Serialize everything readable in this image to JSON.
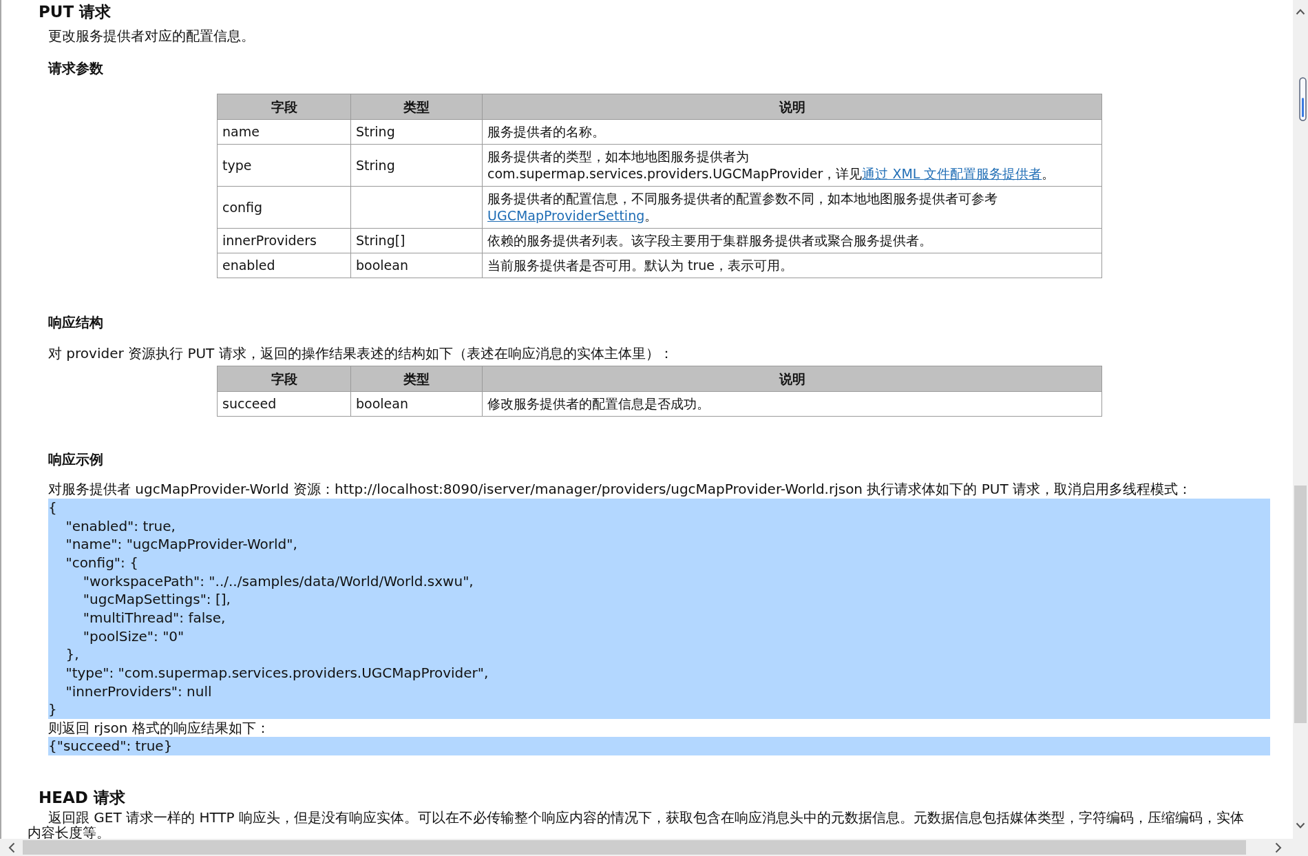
{
  "put_request": {
    "heading": "PUT 请求",
    "description": "更改服务提供者对应的配置信息。",
    "request_parameters": {
      "heading": "请求参数",
      "table": {
        "columns": [
          "字段",
          "类型",
          "说明"
        ],
        "rows": [
          {
            "field": "name",
            "type": "String",
            "description": [
              {
                "kind": "text",
                "text": "服务提供者的名称。"
              }
            ]
          },
          {
            "field": "type",
            "type": "String",
            "description": [
              {
                "kind": "text",
                "text": "服务提供者的类型，如本地地图服务提供者为 com.supermap.services.providers.UGCMapProvider，详见"
              },
              {
                "kind": "link",
                "text": "通过 XML 文件配置服务提供者"
              },
              {
                "kind": "text",
                "text": "。"
              }
            ]
          },
          {
            "field": "config",
            "description": [
              {
                "kind": "text",
                "text": "服务提供者的配置信息，不同服务提供者的配置参数不同，如本地地图服务提供者可参考"
              },
              {
                "kind": "link",
                "text": "UGCMapProviderSetting"
              },
              {
                "kind": "text",
                "text": "。"
              }
            ]
          },
          {
            "field": "innerProviders",
            "type": "String[]",
            "description": [
              {
                "kind": "text",
                "text": "依赖的服务提供者列表。该字段主要用于集群服务提供者或聚合服务提供者。"
              }
            ]
          },
          {
            "field": "enabled",
            "type": "boolean",
            "description": [
              {
                "kind": "text",
                "text": "当前服务提供者是否可用。默认为 true，表示可用。"
              }
            ]
          }
        ]
      }
    },
    "response_structure": {
      "heading": "响应结构",
      "intro": "对 provider 资源执行 PUT 请求，返回的操作结果表述的结构如下（表述在响应消息的实体主体里）：",
      "table": {
        "columns": [
          "字段",
          "类型",
          "说明"
        ],
        "rows": [
          {
            "field": "succeed",
            "type": "boolean",
            "description": [
              {
                "kind": "text",
                "text": "修改服务提供者的配置信息是否成功。"
              }
            ]
          }
        ]
      }
    },
    "response_example": {
      "heading": "响应示例",
      "intro": "对服务提供者 ugcMapProvider-World 资源：http://localhost:8090/iserver/manager/providers/ugcMapProvider-World.rjson 执行请求体如下的 PUT 请求，取消启用多线程模式：",
      "request_body": [
        "{",
        "    \"enabled\": true,",
        "    \"name\": \"ugcMapProvider-World\",",
        "    \"config\": {",
        "        \"workspacePath\": \"../../samples/data/World/World.sxwu\",",
        "        \"ugcMapSettings\": [],",
        "        \"multiThread\": false,",
        "        \"poolSize\": \"0\"",
        "    },",
        "    \"type\": \"com.supermap.services.providers.UGCMapProvider\",",
        "    \"innerProviders\": null",
        "}"
      ],
      "result_intro": "则返回 rjson 格式的响应结果如下：",
      "result_body": [
        "{\"succeed\": true}"
      ]
    }
  },
  "head_request": {
    "heading": "HEAD 请求",
    "lines": [
      "返回跟 GET 请求一样的 HTTP 响应头，但是没有响应实体。可以在不必传输整个响应内容的情况下，获取包含在响应消息头中的元数据信息。元数据信息包括媒体类型，字符编码，压缩编码，实体",
      "内容长度等。"
    ]
  }
}
